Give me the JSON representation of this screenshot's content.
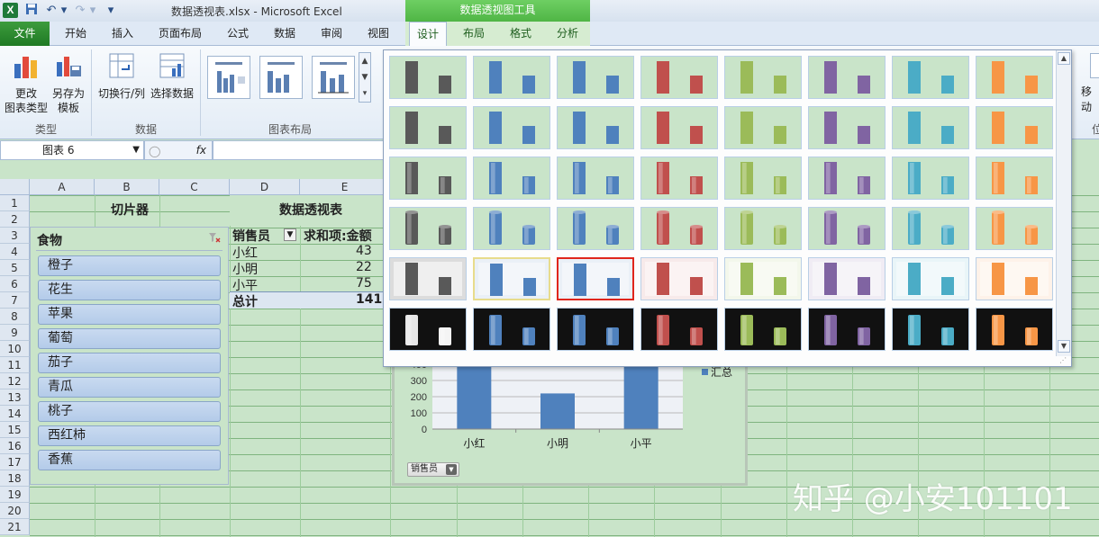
{
  "window": {
    "title": "数据透视表.xlsx  -  Microsoft Excel",
    "context_tools_title": "数据透视图工具",
    "app_icon": "X"
  },
  "quick_access": [
    "save-icon",
    "undo-icon",
    "redo-icon",
    "customize-icon"
  ],
  "ribbon_tabs": {
    "file": "文件",
    "tabs": [
      "开始",
      "插入",
      "页面布局",
      "公式",
      "数据",
      "审阅",
      "视图"
    ],
    "context_tabs": [
      "设计",
      "布局",
      "格式",
      "分析"
    ],
    "active": "设计"
  },
  "ribbon": {
    "type_group": {
      "change_type": "更改\n图表类型",
      "save_template": "另存为\n模板",
      "label": "类型"
    },
    "data_group": {
      "switch_row_col": "切换行/列",
      "select_data": "选择数据",
      "label": "数据"
    },
    "layout_group": {
      "label": "图表布局"
    },
    "right_cut_label": "移动",
    "right_cut_small": "位"
  },
  "formula_bar": {
    "name_box": "图表 6",
    "fx": "fx"
  },
  "columns": [
    "A",
    "B",
    "C",
    "D",
    "E"
  ],
  "rows": [
    "1",
    "2",
    "3",
    "4",
    "5",
    "6",
    "7",
    "8",
    "9",
    "10",
    "11",
    "12",
    "13",
    "14",
    "15",
    "16",
    "17",
    "18",
    "19",
    "20",
    "21"
  ],
  "slicer": {
    "caption": "切片器",
    "header": "食物",
    "items": [
      "橙子",
      "花生",
      "苹果",
      "葡萄",
      "茄子",
      "青瓜",
      "桃子",
      "西红柿",
      "香蕉"
    ]
  },
  "pivot": {
    "caption": "数据透视表",
    "row_field": "销售员",
    "value_field": "求和项:金额",
    "rows": [
      {
        "name": "小红",
        "value": "43"
      },
      {
        "name": "小明",
        "value": "22"
      },
      {
        "name": "小平",
        "value": "75"
      }
    ],
    "total_label": "总计",
    "total_value": "141"
  },
  "chart_data": {
    "type": "bar",
    "categories": [
      "小红",
      "小明",
      "小平"
    ],
    "series": [
      {
        "name": "汇总",
        "values": [
          430,
          220,
          750
        ]
      }
    ],
    "yticks": [
      "0",
      "100",
      "200",
      "300",
      "400"
    ],
    "ylim": [
      0,
      400
    ],
    "legend": "right",
    "field_button": "销售员"
  },
  "gallery": {
    "colors": [
      "#595959",
      "#4f81bd",
      "#4f81bd",
      "#c0504d",
      "#9bbb59",
      "#8064a2",
      "#4bacc6",
      "#f79646"
    ],
    "selected_row": 4,
    "selected_col": 2
  },
  "watermark": "知乎 @小安101101"
}
